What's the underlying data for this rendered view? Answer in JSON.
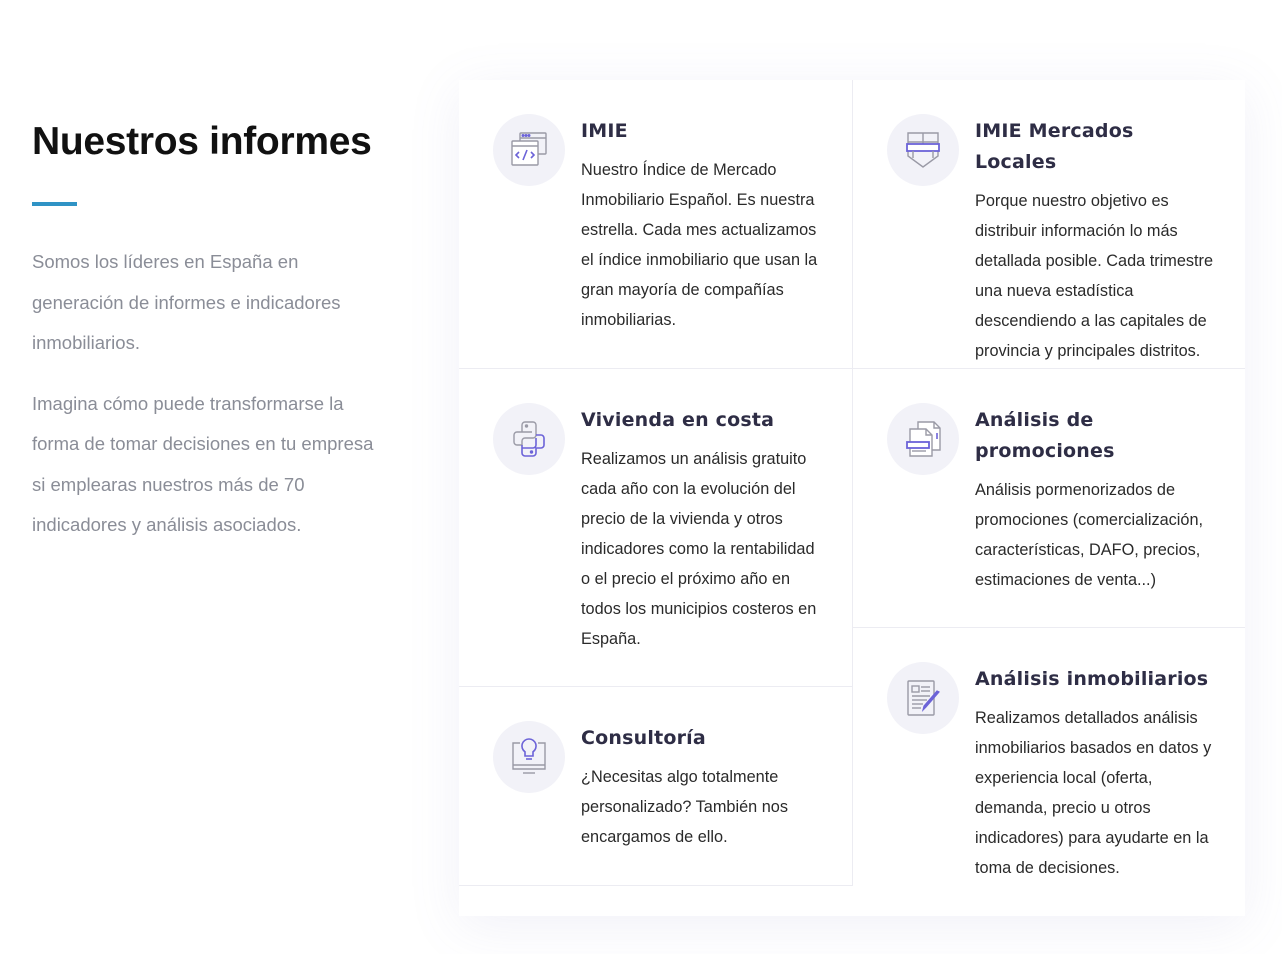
{
  "intro": {
    "title": "Nuestros informes",
    "paragraph_1": "Somos los líderes en España en generación de informes e indicadores inmobiliarios.",
    "paragraph_2": "Imagina cómo puede transformarse la forma de tomar decisiones en tu empresa si emplearas nuestros más de 70 indicadores y análisis asociados.",
    "accent_color": "#2f93c5"
  },
  "cards": {
    "imie": {
      "title": "IMIE",
      "description": "Nuestro Índice de Mercado Inmobiliario Español. Es nuestra estrella. Cada mes actualizamos el índice inmobiliario que usan la gran mayoría de compañías inmobiliarias.",
      "icon": "code-window-icon"
    },
    "mercados_locales": {
      "title": "IMIE Mercados Locales",
      "description": "Porque nuestro objetivo es distribuir información lo más detallada posible. Cada trimestre una nueva estadística descendiendo a las capitales de provincia y principales distritos.",
      "icon": "shield-icon"
    },
    "vivienda_costa": {
      "title": "Vivienda en costa",
      "description": "Realizamos un análisis gratuito cada año con la evolución del precio de la vivienda y otros indicadores como la rentabilidad o el precio el próximo año en todos los municipios costeros en España.",
      "icon": "python-icon"
    },
    "promociones": {
      "title": "Análisis de promociones",
      "description": "Análisis pormenorizados de promociones (comercialización, características, DAFO, precios, estimaciones de venta...)",
      "icon": "documents-icon"
    },
    "consultoria": {
      "title": "Consultoría",
      "description": "¿Necesitas algo totalmente personalizado? También nos encargamos de ello.",
      "icon": "lightbulb-monitor-icon"
    },
    "inmobiliarios": {
      "title": "Análisis inmobiliarios",
      "description": "Realizamos detallados análisis inmobiliarios basados en datos y experiencia local (oferta, demanda, precio u otros indicadores) para ayudarte en la toma de decisiones.",
      "icon": "document-edit-icon"
    }
  },
  "colors": {
    "icon_stroke": "#9a9aa6",
    "icon_accent": "#6c63d8",
    "icon_bg": "#f2f2f8"
  }
}
